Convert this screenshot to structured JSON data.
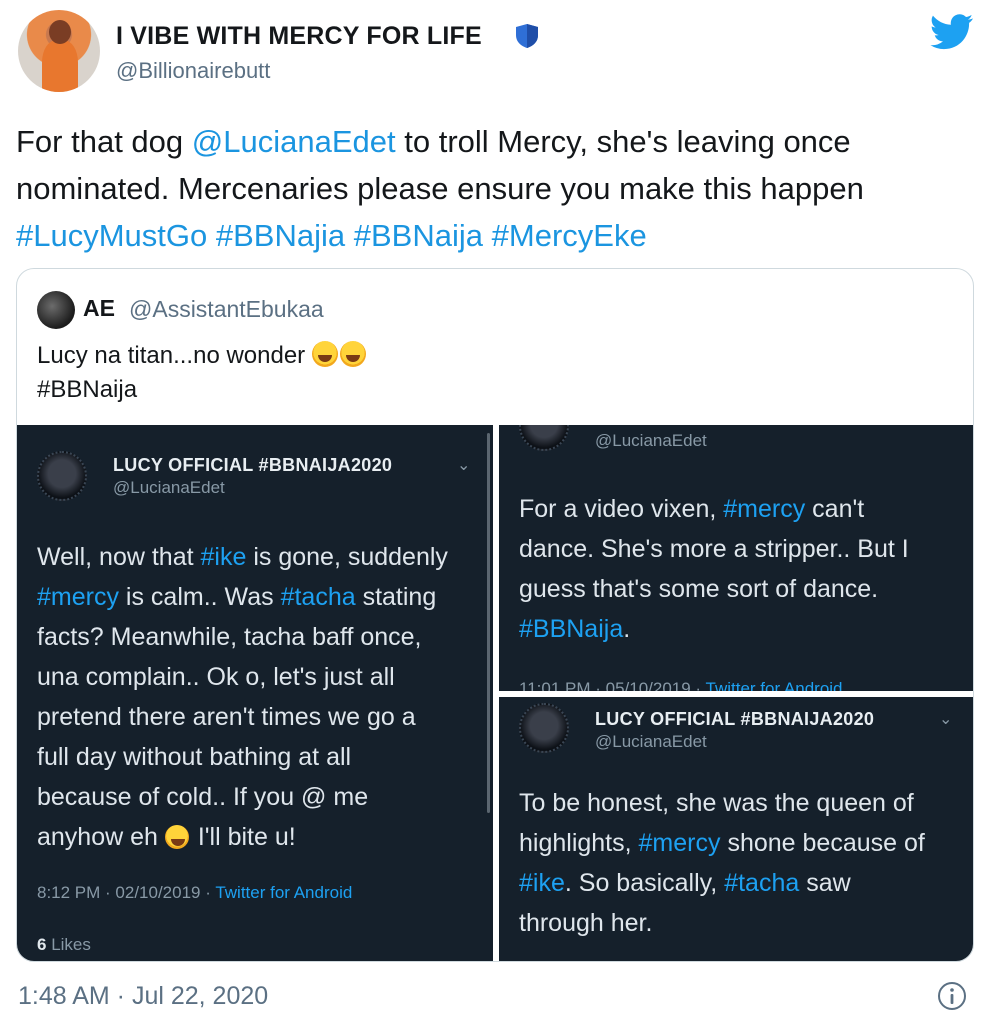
{
  "tweet": {
    "display_name": "I VIBE WITH MERCY FOR LIFE",
    "handle": "@Billionairebutt",
    "text_parts": [
      {
        "t": "For that dog ",
        "link": false
      },
      {
        "t": "@LucianaEdet",
        "link": true
      },
      {
        "t": " to troll Mercy, she's leaving once nominated. Mercenaries please ensure you make this happen ",
        "link": false
      },
      {
        "t": "#LucyMustGo",
        "link": true
      },
      {
        "t": " ",
        "link": false
      },
      {
        "t": "#BBNajia",
        "link": true
      },
      {
        "t": " ",
        "link": false
      },
      {
        "t": "#BBNaija",
        "link": true
      },
      {
        "t": " ",
        "link": false
      },
      {
        "t": "#MercyEke",
        "link": true
      }
    ],
    "timestamp": "1:48 AM · Jul 22, 2020",
    "icons": {
      "verified_badge": "shield-icon",
      "brand": "twitter-bird-icon",
      "info": "info-icon"
    },
    "colors": {
      "link": "#1b95e0",
      "brand": "#1da1f2",
      "dark_bg": "#15202b"
    }
  },
  "quote": {
    "name": "AE",
    "handle": "@AssistantEbukaa",
    "line1": "Lucy na titan...no wonder",
    "line2": "#BBNaija",
    "emoji": "tears-of-joy-emoji"
  },
  "screenshots": {
    "left": {
      "name": "LUCY OFFICIAL #BBNAIJA2020",
      "handle": "@LucianaEdet",
      "lines": [
        [
          {
            "t": "Well, now that ",
            "b": false
          },
          {
            "t": "#ike",
            "b": true
          },
          {
            "t": " is gone, suddenly",
            "b": false
          }
        ],
        [
          {
            "t": "#mercy",
            "b": true
          },
          {
            "t": " is calm.. Was ",
            "b": false
          },
          {
            "t": "#tacha",
            "b": true
          },
          {
            "t": " stating",
            "b": false
          }
        ],
        [
          {
            "t": "facts? Meanwhile, tacha baff once,",
            "b": false
          }
        ],
        [
          {
            "t": "una complain.. Ok o, let's just all",
            "b": false
          }
        ],
        [
          {
            "t": "pretend there aren't times we go a",
            "b": false
          }
        ],
        [
          {
            "t": "full day without bathing at all",
            "b": false
          }
        ],
        [
          {
            "t": "because of cold.. If you @ me",
            "b": false
          }
        ],
        [
          {
            "t": "anyhow eh ",
            "b": false
          },
          {
            "t": "🙄",
            "b": false,
            "emoji": true
          },
          {
            "t": " I'll bite u!",
            "b": false
          }
        ]
      ],
      "meta_time": "8:12 PM · 02/10/2019 · ",
      "meta_client": "Twitter for Android",
      "likes_count": "6",
      "likes_label": " Likes"
    },
    "right_top": {
      "handle": "@LucianaEdet",
      "lines": [
        [
          {
            "t": "For a video vixen, ",
            "b": false
          },
          {
            "t": "#mercy",
            "b": true
          },
          {
            "t": " can't",
            "b": false
          }
        ],
        [
          {
            "t": "dance. She's more a stripper.. But I",
            "b": false
          }
        ],
        [
          {
            "t": "guess that's some sort of dance.",
            "b": false
          }
        ],
        [
          {
            "t": "#BBNaija",
            "b": true
          },
          {
            "t": ".",
            "b": false
          }
        ]
      ],
      "meta_time": "11:01 PM · 05/10/2019 · ",
      "meta_client": "Twitter for Android"
    },
    "right_bottom": {
      "name": "LUCY OFFICIAL #BBNAIJA2020",
      "handle": "@LucianaEdet",
      "lines": [
        [
          {
            "t": "To be honest, she was the queen of",
            "b": false
          }
        ],
        [
          {
            "t": "highlights, ",
            "b": false
          },
          {
            "t": "#mercy",
            "b": true
          },
          {
            "t": " shone because of",
            "b": false
          }
        ],
        [
          {
            "t": "#ike",
            "b": true
          },
          {
            "t": ". So basically, ",
            "b": false
          },
          {
            "t": "#tacha",
            "b": true
          },
          {
            "t": " saw",
            "b": false
          }
        ],
        [
          {
            "t": "through her.",
            "b": false
          }
        ]
      ]
    }
  }
}
